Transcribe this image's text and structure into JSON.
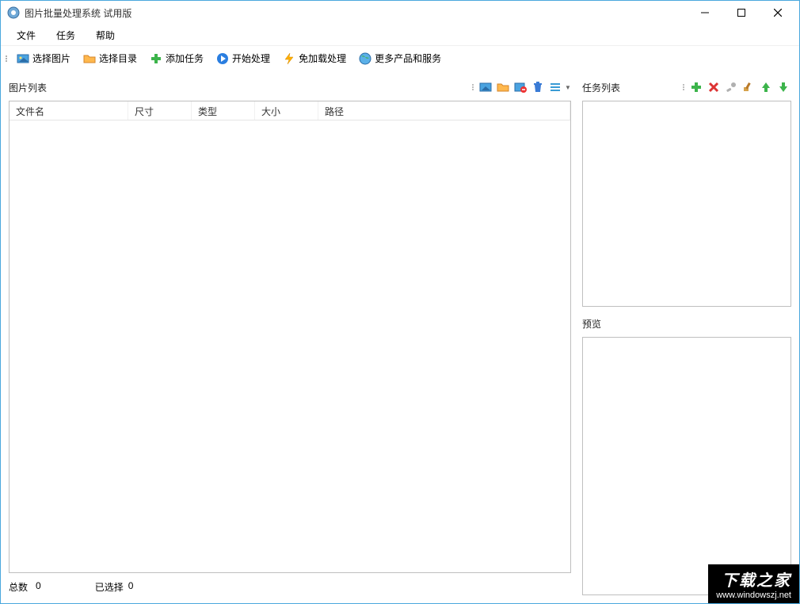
{
  "window": {
    "title": "图片批量处理系统 试用版"
  },
  "menu": {
    "file": "文件",
    "task": "任务",
    "help": "帮助"
  },
  "toolbar": {
    "select_image": "选择图片",
    "select_folder": "选择目录",
    "add_task": "添加任务",
    "start_process": "开始处理",
    "noload_process": "免加载处理",
    "more_products": "更多产品和服务"
  },
  "image_list": {
    "title": "图片列表",
    "columns": {
      "filename": "文件名",
      "dimensions": "尺寸",
      "type": "类型",
      "size": "大小",
      "path": "路径"
    }
  },
  "status": {
    "total_label": "总数",
    "total_value": "0",
    "selected_label": "已选择",
    "selected_value": "0"
  },
  "task_list": {
    "title": "任务列表"
  },
  "preview": {
    "title": "预览"
  },
  "watermark": {
    "line1": "下载之家",
    "line2": "www.windowszj.net"
  }
}
